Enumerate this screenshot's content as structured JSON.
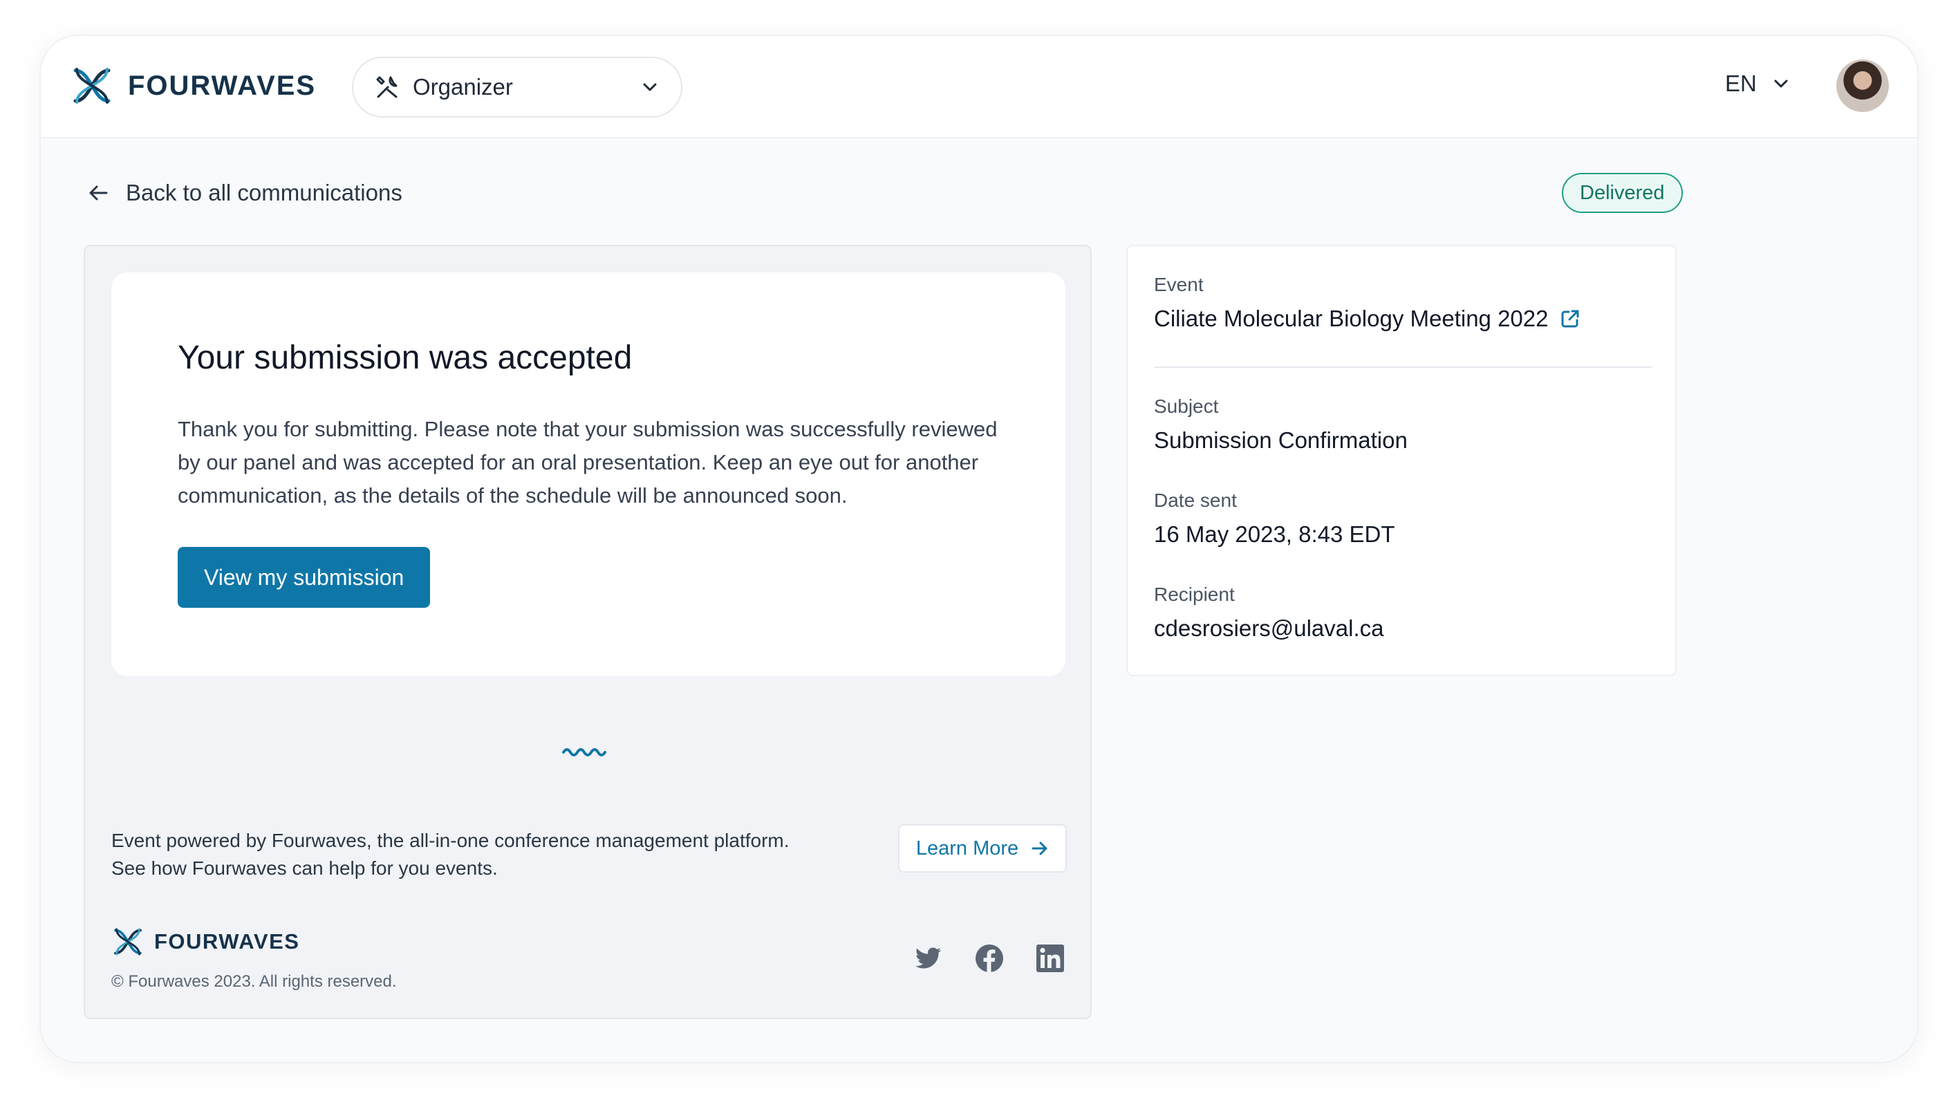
{
  "header": {
    "brand_name": "FOURWAVES",
    "role_select": {
      "value": "Organizer"
    },
    "language": "EN"
  },
  "subheader": {
    "back_label": "Back to all communications",
    "status": "Delivered"
  },
  "email": {
    "title": "Your submission was accepted",
    "body": "Thank you for submitting. Please note that your submission was successfully reviewed by our panel and was accepted for an oral presentation. Keep an eye out for another communication, as the details of the schedule will be announced soon.",
    "cta_label": "View my submission",
    "powered_line1": "Event powered by Fourwaves, the all-in-one conference management platform.",
    "powered_line2": "See how Fourwaves can help for you events.",
    "learn_more_label": "Learn More",
    "footer_brand": "FOURWAVES",
    "copyright": "© Fourwaves 2023.  All rights reserved.",
    "socials": [
      "twitter-icon",
      "facebook-icon",
      "linkedin-icon"
    ]
  },
  "details": {
    "event_label": "Event",
    "event_value": "Ciliate Molecular Biology Meeting 2022",
    "subject_label": "Subject",
    "subject_value": "Submission Confirmation",
    "date_label": "Date sent",
    "date_value": "16 May 2023, 8:43 EDT",
    "recipient_label": "Recipient",
    "recipient_value": "cdesrosiers@ulaval.ca"
  },
  "colors": {
    "brand_blue": "#0f77a8",
    "brand_navy": "#16324a",
    "status_green": "#1f9e86"
  }
}
